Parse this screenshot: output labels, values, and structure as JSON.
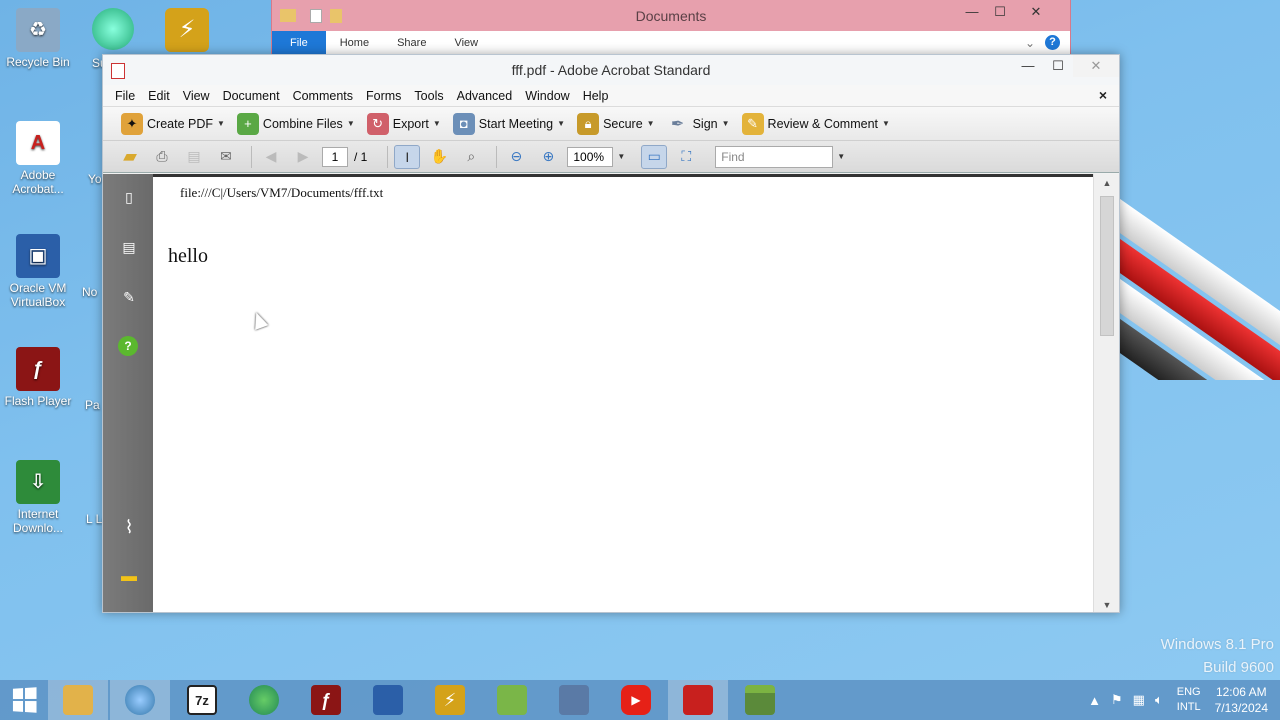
{
  "desktop": {
    "icons": [
      {
        "label": "Recycle Bin",
        "icon": "recycle-bin-icon",
        "color": "#8aa9c6"
      },
      {
        "label": "Adobe Acrobat...",
        "icon": "adobe-acrobat-icon",
        "color": "#ffffff"
      },
      {
        "label": "Oracle VM VirtualBox",
        "icon": "virtualbox-icon",
        "color": "#2b5fa8"
      },
      {
        "label": "Flash Player",
        "icon": "flash-player-icon",
        "color": "#8b1515"
      },
      {
        "label": "Internet Downlo...",
        "icon": "internet-download-icon",
        "color": "#2e8b3a"
      }
    ],
    "partial_labels": [
      "Sup",
      "Yo",
      "No",
      "Pa",
      "L Le"
    ],
    "watermark": {
      "line1": "Windows 8.1 Pro",
      "line2": "Build 9600"
    }
  },
  "explorer": {
    "title": "Documents",
    "tabs": [
      "File",
      "Home",
      "Share",
      "View"
    ],
    "controls": {
      "minimize": "—",
      "maximize": "☐",
      "close": "✕"
    },
    "help": "?"
  },
  "acrobat": {
    "title": "fff.pdf - Adobe Acrobat Standard",
    "controls": {
      "minimize": "—",
      "maximize": "☐",
      "close": "✕"
    },
    "menu": [
      "File",
      "Edit",
      "View",
      "Document",
      "Comments",
      "Forms",
      "Tools",
      "Advanced",
      "Window",
      "Help"
    ],
    "doc_close": "×",
    "toolbar": [
      {
        "label": "Create PDF",
        "icon": "create-pdf-icon",
        "color": "#e0a23a"
      },
      {
        "label": "Combine Files",
        "icon": "combine-files-icon",
        "color": "#5aa845"
      },
      {
        "label": "Export",
        "icon": "export-icon",
        "color": "#d0606a"
      },
      {
        "label": "Start Meeting",
        "icon": "meeting-icon",
        "color": "#6c8fb8"
      },
      {
        "label": "Secure",
        "icon": "lock-icon",
        "color": "#c79a2a"
      },
      {
        "label": "Sign",
        "icon": "pen-icon",
        "color": "#6a7e9a"
      },
      {
        "label": "Review & Comment",
        "icon": "review-icon",
        "color": "#e3b33a"
      }
    ],
    "nav": {
      "page": "1",
      "total": "/ 1",
      "zoom": "100%",
      "find_placeholder": "Find"
    },
    "document": {
      "header": "file:///C|/Users/VM7/Documents/fff.txt",
      "body": "hello"
    }
  },
  "taskbar": {
    "apps": [
      {
        "name": "file-explorer",
        "glyph": "",
        "color": "#e2b24a",
        "active": true
      },
      {
        "name": "chrome-like",
        "glyph": "",
        "color": "#3c7a3c",
        "active": true
      },
      {
        "name": "7zip",
        "glyph": "7z",
        "color": "#222222",
        "active": false
      },
      {
        "name": "download-manager",
        "glyph": "",
        "color": "#2e8b3a",
        "active": false
      },
      {
        "name": "flash",
        "glyph": "ƒ",
        "color": "#8b1515",
        "active": false
      },
      {
        "name": "virtualbox",
        "glyph": "",
        "color": "#2b5fa8",
        "active": false
      },
      {
        "name": "winamp",
        "glyph": "⚡",
        "color": "#d4a21a",
        "active": false
      },
      {
        "name": "notepad-plus",
        "glyph": "",
        "color": "#7ab648",
        "active": false
      },
      {
        "name": "tools",
        "glyph": "",
        "color": "#5a7aa6",
        "active": false
      },
      {
        "name": "youtube",
        "glyph": "▶",
        "color": "#e62117",
        "active": false
      },
      {
        "name": "acrobat",
        "glyph": "",
        "color": "#c8201e",
        "active": true
      },
      {
        "name": "minecraft",
        "glyph": "",
        "color": "#5b8a3a",
        "active": false
      }
    ],
    "tray": {
      "lang1": "ENG",
      "lang2": "INTL",
      "time": "12:06 AM",
      "date": "7/13/2024"
    }
  }
}
